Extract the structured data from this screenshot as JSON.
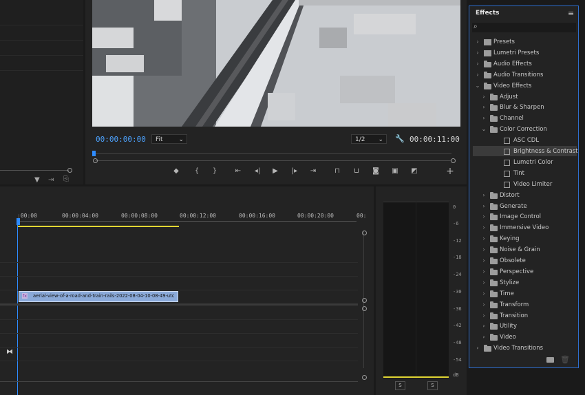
{
  "colors": {
    "accent": "#4da3ff",
    "panel_border": "#2e6fd0",
    "clip": "#8aa9d8",
    "playhead": "#2e8bff",
    "work_area": "#e2d633"
  },
  "program_monitor": {
    "current_timecode": "00:00:00:00",
    "fit_label": "Fit",
    "resolution_label": "1/2",
    "duration_timecode": "00:00:11:00",
    "controls": [
      "marker-icon",
      "mark-in-icon",
      "mark-out-icon",
      "go-to-in-icon",
      "step-back-icon",
      "play-icon",
      "step-forward-icon",
      "go-to-out-icon",
      "lift-icon",
      "extract-icon",
      "export-frame-icon",
      "compare-icon",
      "comparison-view-icon",
      "add-icon"
    ]
  },
  "timeline": {
    "ruler": [
      ":00:00",
      "00:00:04:00",
      "00:00:08:00",
      "00:00:12:00",
      "00:00:16:00",
      "00:00:20:00",
      "00:"
    ],
    "clip_badge": "fx",
    "clip_name": "aerial-view-of-a-road-and-train-rails-2022-08-04-10-08-49-utc"
  },
  "audio_meter": {
    "db_labels": [
      "0",
      "-6",
      "-12",
      "-18",
      "-24",
      "-30",
      "-36",
      "-42",
      "-48",
      "-54",
      "dB"
    ],
    "solo_labels": [
      "S",
      "S"
    ]
  },
  "effects": {
    "title": "Effects",
    "search_placeholder": "",
    "items": [
      {
        "label": "Presets",
        "level": 0,
        "icon": "preset"
      },
      {
        "label": "Lumetri Presets",
        "level": 0,
        "icon": "preset"
      },
      {
        "label": "Audio Effects",
        "level": 0,
        "icon": "folder"
      },
      {
        "label": "Audio Transitions",
        "level": 0,
        "icon": "folder"
      },
      {
        "label": "Video Effects",
        "level": 0,
        "icon": "folder",
        "expanded": true
      },
      {
        "label": "Adjust",
        "level": 1,
        "icon": "folder"
      },
      {
        "label": "Blur & Sharpen",
        "level": 1,
        "icon": "folder"
      },
      {
        "label": "Channel",
        "level": 1,
        "icon": "folder"
      },
      {
        "label": "Color Correction",
        "level": 1,
        "icon": "folder",
        "expanded": true
      },
      {
        "label": "ASC CDL",
        "level": 2,
        "icon": "fx"
      },
      {
        "label": "Brightness & Contrast",
        "level": 2,
        "icon": "fx",
        "selected": true
      },
      {
        "label": "Lumetri Color",
        "level": 2,
        "icon": "fx"
      },
      {
        "label": "Tint",
        "level": 2,
        "icon": "fx"
      },
      {
        "label": "Video Limiter",
        "level": 2,
        "icon": "fx"
      },
      {
        "label": "Distort",
        "level": 1,
        "icon": "folder"
      },
      {
        "label": "Generate",
        "level": 1,
        "icon": "folder"
      },
      {
        "label": "Image Control",
        "level": 1,
        "icon": "folder"
      },
      {
        "label": "Immersive Video",
        "level": 1,
        "icon": "folder"
      },
      {
        "label": "Keying",
        "level": 1,
        "icon": "folder"
      },
      {
        "label": "Noise & Grain",
        "level": 1,
        "icon": "folder"
      },
      {
        "label": "Obsolete",
        "level": 1,
        "icon": "folder"
      },
      {
        "label": "Perspective",
        "level": 1,
        "icon": "folder"
      },
      {
        "label": "Stylize",
        "level": 1,
        "icon": "folder"
      },
      {
        "label": "Time",
        "level": 1,
        "icon": "folder"
      },
      {
        "label": "Transform",
        "level": 1,
        "icon": "folder"
      },
      {
        "label": "Transition",
        "level": 1,
        "icon": "folder"
      },
      {
        "label": "Utility",
        "level": 1,
        "icon": "folder"
      },
      {
        "label": "Video",
        "level": 1,
        "icon": "folder"
      },
      {
        "label": "Video Transitions",
        "level": 0,
        "icon": "folder"
      }
    ]
  }
}
